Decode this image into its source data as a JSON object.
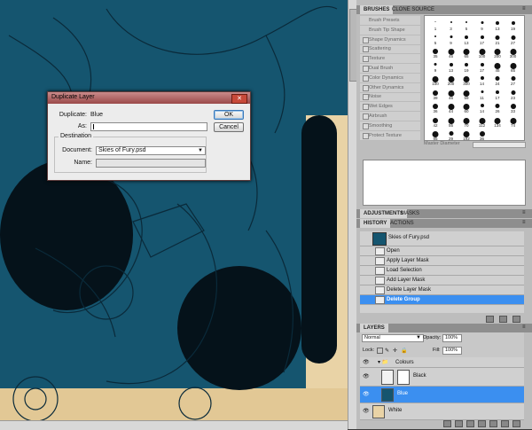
{
  "dialog": {
    "title": "Duplicate Layer",
    "duplicate_label": "Duplicate:",
    "duplicate_value": "Blue",
    "as_label": "As:",
    "as_value": "",
    "ok_label": "OK",
    "cancel_label": "Cancel",
    "destination_legend": "Destination",
    "document_label": "Document:",
    "document_value": "Skies of Fury.psd",
    "name_label": "Name:",
    "name_value": ""
  },
  "brushes": {
    "tabs": [
      "BRUSHES",
      "CLONE SOURCE"
    ],
    "options": [
      {
        "label": "Brush Presets"
      },
      {
        "label": "Brush Tip Shape"
      },
      {
        "label": "Shape Dynamics"
      },
      {
        "label": "Scattering"
      },
      {
        "label": "Texture"
      },
      {
        "label": "Dual Brush"
      },
      {
        "label": "Color Dynamics"
      },
      {
        "label": "Other Dynamics"
      },
      {
        "label": "Noise"
      },
      {
        "label": "Wet Edges"
      },
      {
        "label": "Airbrush"
      },
      {
        "label": "Smoothing"
      },
      {
        "label": "Protect Texture"
      }
    ],
    "master_diameter_label": "Master Diameter",
    "sizes": [
      "1",
      "3",
      "5",
      "9",
      "13",
      "19",
      "5",
      "9",
      "13",
      "17",
      "21",
      "27",
      "35",
      "45",
      "65",
      "100",
      "200",
      "300",
      "9",
      "13",
      "19",
      "17",
      "45",
      "65",
      "100",
      "200",
      "300",
      "14",
      "24",
      "27",
      "39",
      "46",
      "59",
      "11",
      "17",
      "23",
      "36",
      "44",
      "60",
      "14",
      "26",
      "33",
      "42",
      "55",
      "70",
      "112",
      "134",
      "74",
      "95",
      "29",
      "192",
      "36"
    ]
  },
  "adjustments": {
    "tabs": [
      "ADJUSTMENTS",
      "MASKS"
    ]
  },
  "history": {
    "tabs": [
      "HISTORY",
      "ACTIONS"
    ],
    "snapshot": "Skies of Fury.psd",
    "items": [
      {
        "label": "Open",
        "selected": false
      },
      {
        "label": "Apply Layer Mask",
        "selected": false
      },
      {
        "label": "Load Selection",
        "selected": false
      },
      {
        "label": "Add Layer Mask",
        "selected": false
      },
      {
        "label": "Delete Layer Mask",
        "selected": false
      },
      {
        "label": "Delete Group",
        "selected": true
      }
    ]
  },
  "layers": {
    "tab": "LAYERS",
    "blend_mode": "Normal",
    "opacity_label": "Opacity:",
    "opacity_value": "100%",
    "lock_label": "Lock:",
    "fill_label": "Fill:",
    "fill_value": "100%",
    "items": [
      {
        "name": "Colours",
        "kind": "group"
      },
      {
        "name": "Black",
        "kind": "layer"
      },
      {
        "name": "Blue",
        "kind": "layer",
        "selected": true
      },
      {
        "name": "White",
        "kind": "layer"
      }
    ]
  },
  "colors": {
    "canvas_blue": "#15556f",
    "selection_blue": "#3b8ff0",
    "paper": "#e9d3a6"
  }
}
